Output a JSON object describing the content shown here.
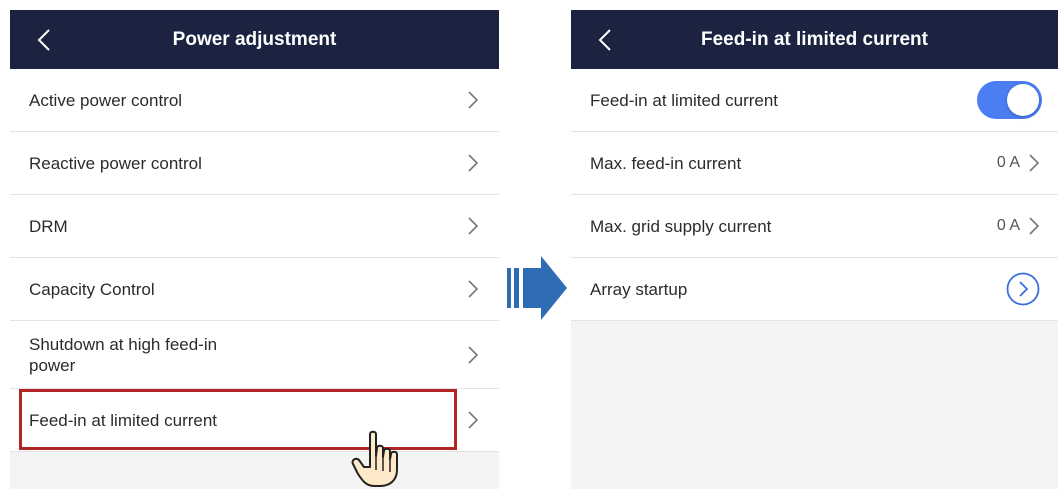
{
  "left_screen": {
    "title": "Power adjustment",
    "items": [
      {
        "label": "Active power control"
      },
      {
        "label": "Reactive power control"
      },
      {
        "label": "DRM"
      },
      {
        "label": "Capacity Control"
      },
      {
        "label": "Shutdown at high feed-in\npower"
      },
      {
        "label": "Feed-in at limited current"
      }
    ]
  },
  "right_screen": {
    "title": "Feed-in at limited current",
    "items": [
      {
        "label": "Feed-in at limited current",
        "toggle_on": true
      },
      {
        "label": "Max. feed-in current",
        "value": "0 A"
      },
      {
        "label": "Max. grid supply current",
        "value": "0 A"
      },
      {
        "label": "Array startup"
      }
    ]
  },
  "icons": {
    "back": "chevron-left-icon",
    "chevron": "chevron-right-icon",
    "circle_chevron": "circle-chevron-right-icon",
    "pointer": "hand-pointer-icon",
    "transition": "arrow-right-icon"
  },
  "colors": {
    "header_bg": "#1b2340",
    "toggle_on": "#4a7ef2",
    "highlight_border": "#b32525",
    "arrow": "#2e6db3"
  }
}
